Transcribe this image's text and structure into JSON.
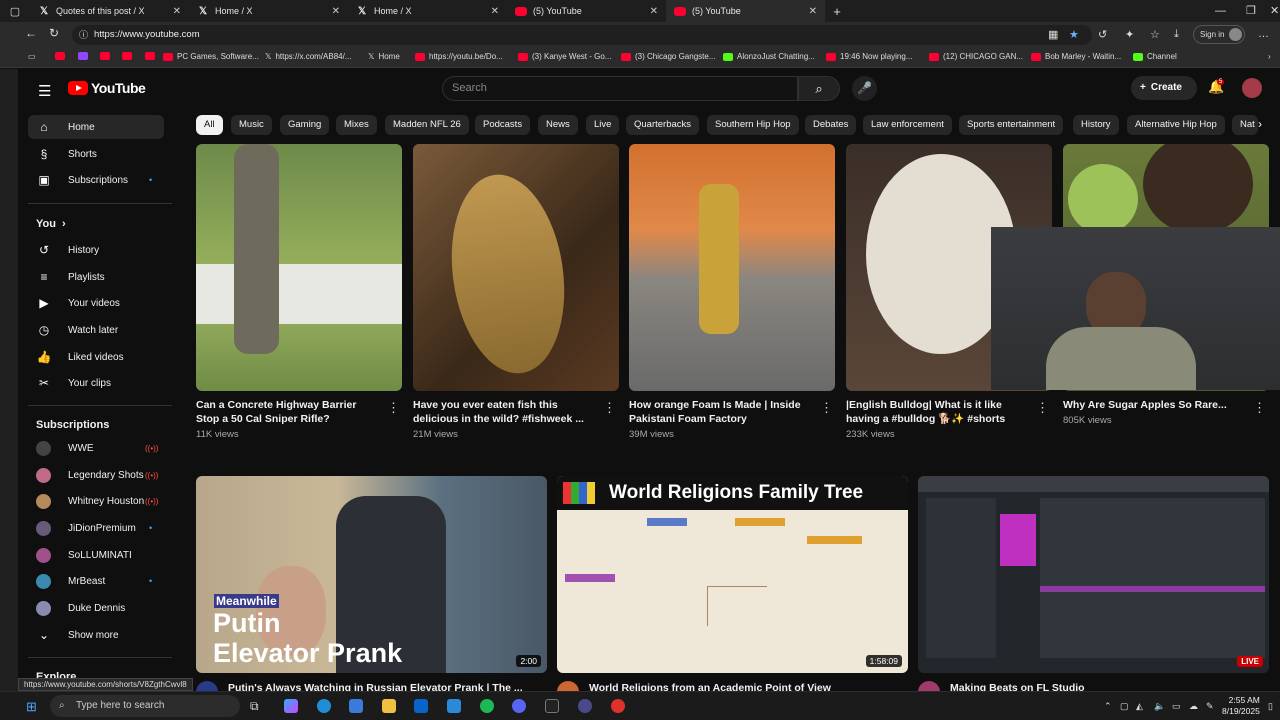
{
  "browser": {
    "tabs": [
      {
        "title": "Quotes of this post / X",
        "icon": "x-logo-icon"
      },
      {
        "title": "Home / X",
        "icon": "x-logo-icon"
      },
      {
        "title": "Home / X",
        "icon": "x-logo-icon"
      },
      {
        "title": "(5) YouTube",
        "icon": "youtube-icon"
      },
      {
        "title": "(5) YouTube",
        "icon": "youtube-icon"
      }
    ],
    "url": "https://www.youtube.com",
    "sign_in": "Sign in",
    "bookmarks": [
      "PC Games, Software...",
      "https://x.com/AB84/...",
      "Home",
      "https://youtu.be/Do...",
      "(3) Kanye West - Go...",
      "(3) Chicago Gangste...",
      "AlonzoJust Chatting...",
      "19:46 Now playing...",
      "(12) CHICAGO GAN...",
      "Bob Marley - Waitin...",
      "Channel"
    ]
  },
  "youtube": {
    "logo": "YouTube",
    "search_placeholder": "Search",
    "create_label": "Create",
    "notification_count": "5",
    "sidebar": {
      "main": [
        {
          "label": "Home",
          "icon": "home-icon",
          "active": true
        },
        {
          "label": "Shorts",
          "icon": "shorts-icon"
        },
        {
          "label": "Subscriptions",
          "icon": "subscriptions-icon"
        }
      ],
      "you_header": "You",
      "you_items": [
        {
          "label": "History",
          "icon": "history-icon"
        },
        {
          "label": "Playlists",
          "icon": "playlists-icon"
        },
        {
          "label": "Your videos",
          "icon": "your-videos-icon"
        },
        {
          "label": "Watch later",
          "icon": "watch-later-icon"
        },
        {
          "label": "Liked videos",
          "icon": "like-icon"
        },
        {
          "label": "Your clips",
          "icon": "scissors-icon"
        }
      ],
      "subscriptions_header": "Subscriptions",
      "subscriptions": [
        {
          "label": "WWE",
          "color": "#444444",
          "live": true
        },
        {
          "label": "Legendary Shots",
          "color": "#c06a8a",
          "live": true
        },
        {
          "label": "Whitney Houston",
          "color": "#b48a5a",
          "live": true
        },
        {
          "label": "JiDionPremium",
          "color": "#6a5a7a",
          "dot": true
        },
        {
          "label": "SoLLUMINATI",
          "color": "#a0508a"
        },
        {
          "label": "MrBeast",
          "color": "#3a8ab0",
          "dot": true
        },
        {
          "label": "Duke Dennis",
          "color": "#8a8ab0"
        }
      ],
      "show_more": "Show more",
      "explore_header": "Explore"
    },
    "chips": [
      "All",
      "Music",
      "Gaming",
      "Mixes",
      "Madden NFL 26",
      "Podcasts",
      "News",
      "Live",
      "Quarterbacks",
      "Southern Hip Hop",
      "Debates",
      "Law enforcement",
      "Sports entertainment",
      "History",
      "Alternative Hip Hop",
      "Nat"
    ],
    "shorts": [
      {
        "title": "Can a Concrete Highway Barrier Stop a 50 Cal Sniper Rifle?",
        "views": "11K views"
      },
      {
        "title": "Have you ever eaten fish this delicious in the wild?  #fishweek ...",
        "views": "21M views"
      },
      {
        "title": "How orange Foam Is Made | Inside Pakistani Foam Factory",
        "views": "39M views"
      },
      {
        "title": "|English Bulldog| What is it like having a #bulldog 🐕✨ #shorts",
        "views": "233K views"
      },
      {
        "title": "Why Are Sugar Apples So Rare...",
        "views": "805K views"
      }
    ],
    "videos": [
      {
        "title": "Putin's Always Watching in Russian Elevator Prank | The ...",
        "duration": "2:00",
        "overlay_small": "Meanwhile",
        "overlay_big1": "Putin",
        "overlay_big2": "Elevator Prank"
      },
      {
        "title": "World Religions from an Academic Point of View",
        "duration": "1:58:09",
        "overlay_title": "World Religions Family Tree"
      },
      {
        "title": "Making Beats on FL Studio",
        "badge": "LIVE"
      }
    ]
  },
  "status_url": "https://www.youtube.com/shorts/V8ZgthCwvl8",
  "taskbar": {
    "search_placeholder": "Type here to search",
    "time": "2:55 AM",
    "date": "8/19/2025"
  }
}
